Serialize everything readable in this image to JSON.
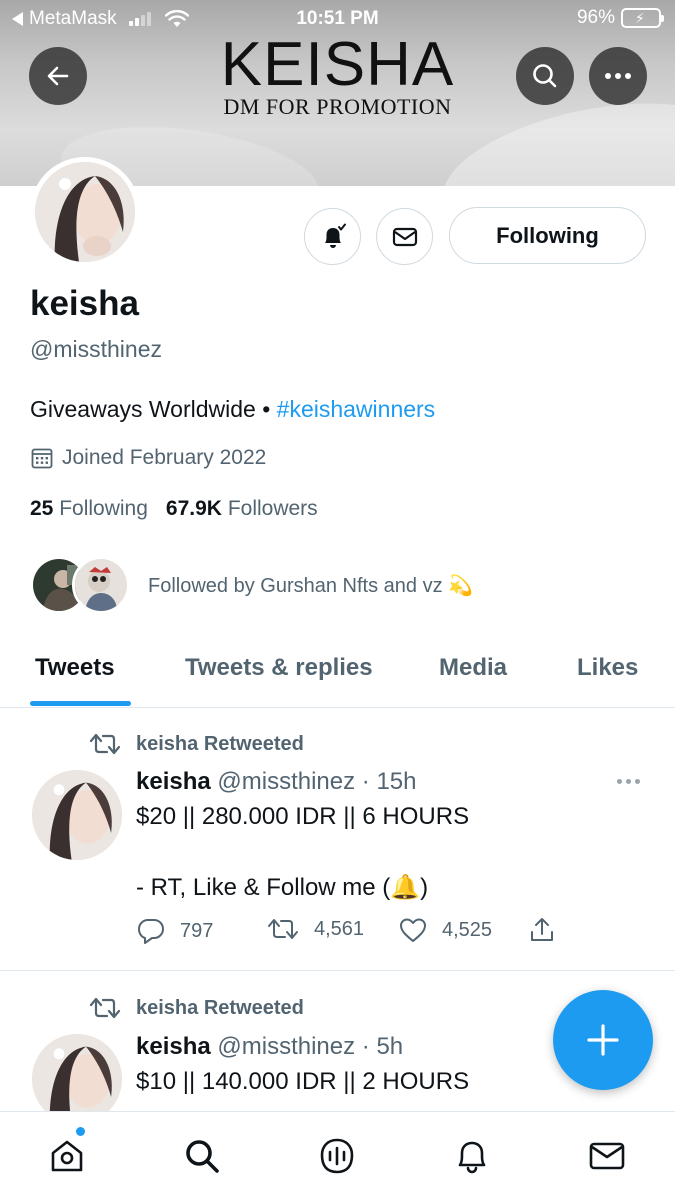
{
  "status_bar": {
    "back_app": "MetaMask",
    "time": "10:51 PM",
    "battery": "96%"
  },
  "banner": {
    "title": "KEISHA",
    "subtitle": "DM FOR PROMOTION"
  },
  "profile": {
    "display_name": "keisha",
    "handle": "@missthinez",
    "bio_text": "Giveaways Worldwide • ",
    "bio_hashtag": "#keishawinners",
    "joined": "Joined February 2022",
    "following_count": "25",
    "following_label": "Following",
    "followers_count": "67.9K",
    "followers_label": "Followers",
    "followed_by": "Followed by Gurshan Nfts and vz 💫",
    "following_button": "Following"
  },
  "tabs": [
    {
      "label": "Tweets",
      "active": true
    },
    {
      "label": "Tweets & replies",
      "active": false
    },
    {
      "label": "Media",
      "active": false
    },
    {
      "label": "Likes",
      "active": false
    }
  ],
  "tweets": [
    {
      "retweet_label": "keisha Retweeted",
      "name": "keisha",
      "handle_time": "@missthinez · 15h",
      "line1": "$20 || 280.000 IDR || 6 HOURS",
      "line2": "- RT, Like & Follow me (🔔)",
      "replies": "797",
      "retweets": "4,561",
      "likes": "4,525"
    },
    {
      "retweet_label": "keisha Retweeted",
      "name": "keisha",
      "handle_time": "@missthinez · 5h",
      "line1": "$10 || 140.000 IDR || 2 HOURS"
    }
  ],
  "icons": {
    "back": "arrow-left-icon",
    "search": "search-icon",
    "more": "more-icon",
    "bell": "bell-icon",
    "mail": "mail-icon",
    "calendar": "calendar-icon",
    "retweet": "retweet-icon",
    "reply": "reply-icon",
    "like": "heart-icon",
    "share": "share-icon",
    "compose": "plus-icon",
    "home": "home-icon",
    "explore": "search-icon",
    "spaces": "spaces-icon",
    "notifications": "bell-icon",
    "messages": "mail-icon"
  },
  "colors": {
    "accent": "#1d9bf0",
    "text_primary": "#0f1419",
    "text_secondary": "#536471",
    "border": "#cfd9de",
    "battery": "#4cd964"
  }
}
